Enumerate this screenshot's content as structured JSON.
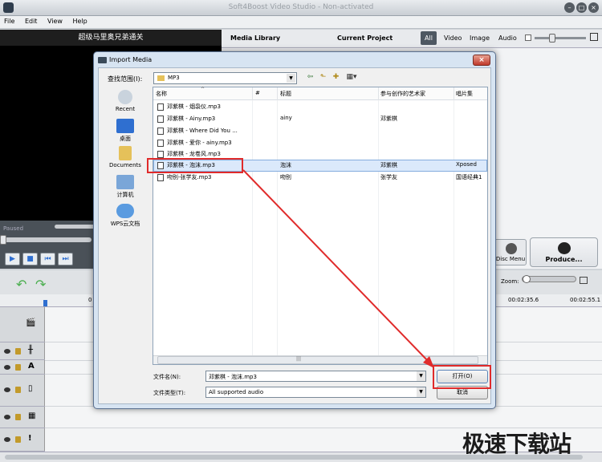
{
  "window": {
    "title": "Soft4Boost Video Studio - Non-activated"
  },
  "menu": [
    "File",
    "Edit",
    "View",
    "Help"
  ],
  "preview": {
    "title": "超级马里奥兄弟通关",
    "status": "Paused"
  },
  "right_panel": {
    "tab_media": "Media Library",
    "tab_project": "Current Project",
    "filters": [
      "All",
      "Video",
      "Image",
      "Audio"
    ],
    "disc_menu": "Disc Menu",
    "produce": "Produce..."
  },
  "timeline": {
    "zoom_label": "Zoom:",
    "ticks": [
      "0",
      "00:02:35.6",
      "00:02:55.1"
    ]
  },
  "dialog": {
    "title": "Import Media",
    "look_in_label": "查找范围(I):",
    "look_in_value": "MP3",
    "places": [
      "Recent",
      "桌面",
      "Documents",
      "计算机",
      "WPS云文档"
    ],
    "columns": [
      "名称",
      "#",
      "标题",
      "参与创作的艺术家",
      "唱片集"
    ],
    "files": [
      {
        "name": "邓紫棋 - 烟袅仪.mp3",
        "title": "",
        "artist": "",
        "album": ""
      },
      {
        "name": "邓紫棋 - Ainy.mp3",
        "title": "ainy",
        "artist": "邓紫棋",
        "album": ""
      },
      {
        "name": "邓紫棋 - Where Did You ...",
        "title": "",
        "artist": "",
        "album": ""
      },
      {
        "name": "邓紫棋 - 爱你 - ainy.mp3",
        "title": "",
        "artist": "",
        "album": ""
      },
      {
        "name": "邓紫棋 - 龙卷风.mp3",
        "title": "",
        "artist": "",
        "album": ""
      },
      {
        "name": "邓紫棋 - 泡沫.mp3",
        "title": "泡沫",
        "artist": "邓紫棋",
        "album": "Xposed"
      },
      {
        "name": "吻别-张学友.mp3",
        "title": "吻别",
        "artist": "张学友",
        "album": "国语经典1"
      }
    ],
    "file_name_label": "文件名(N):",
    "file_name_value": "邓紫棋 - 泡沫.mp3",
    "file_type_label": "文件类型(T):",
    "file_type_value": "All supported audio",
    "open_label": "打开(O)",
    "cancel_label": "取消"
  },
  "watermark": "极速下载站",
  "colors": {
    "highlight": "#e02b2b",
    "selection": "#dbe9fb"
  }
}
